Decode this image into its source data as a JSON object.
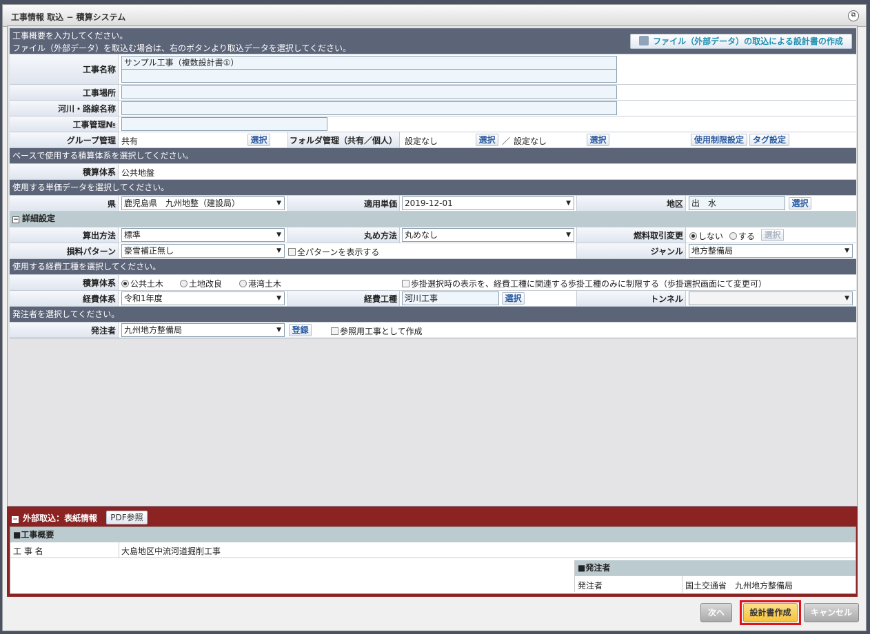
{
  "window": {
    "title": "工事情報 取込 − 積算システム"
  },
  "intro": {
    "line1": "工事概要を入力してください。",
    "line2": "ファイル（外部データ）を取込む場合は、右のボタンより取込データを選択してください。",
    "import_button": "ファイル（外部データ）の取込による設計書の作成"
  },
  "form": {
    "koji_name_label": "工事名称",
    "koji_name_value": "サンプル工事（複数設計書①）",
    "koji_place_label": "工事場所",
    "river_label": "河川・路線名称",
    "koji_no_label": "工事管理№",
    "group_label": "グループ管理",
    "group_value": "共有",
    "select_label": "選択",
    "folder_label": "フォルダ管理（共有／個人）",
    "folder_value1": "設定なし",
    "folder_sep": "／",
    "folder_value2": "設定なし",
    "usage_limit_button": "使用制限設定",
    "tag_button": "タグ設定"
  },
  "section_base": {
    "header": "ベースで使用する積算体系を選択してください。",
    "label": "積算体系",
    "value": "公共地盤"
  },
  "section_unit": {
    "header": "使用する単価データを選択してください。",
    "pref_label": "県",
    "pref_value": "鹿児島県　九州地整（建設局）",
    "date_label": "適用単価",
    "date_value": "2019-12-01",
    "area_label": "地区",
    "area_value": "出　水"
  },
  "detail": {
    "title": "詳細設定",
    "calc_label": "算出方法",
    "calc_value": "標準",
    "round_label": "丸め方法",
    "round_value": "丸めなし",
    "fuel_label": "燃料取引変更",
    "fuel_no": "しない",
    "fuel_yes": "する",
    "loss_label": "損料パターン",
    "loss_value": "豪雪補正無し",
    "show_all_patterns": "全パターンを表示する",
    "genre_label": "ジャンル",
    "genre_value": "地方整備局"
  },
  "section_expense": {
    "header": "使用する経費工種を選択してください。",
    "system_label": "積算体系",
    "opt1": "公共土木",
    "opt2": "土地改良",
    "opt3": "港湾土木",
    "restrict_text": "歩掛選択時の表示を、経費工種に関連する歩掛工種のみに制限する（歩掛選択画面にて変更可）",
    "exp_system_label": "経費体系",
    "exp_system_value": "令和1年度",
    "exp_type_label": "経費工種",
    "exp_type_value": "河川工事",
    "tunnel_label": "トンネル"
  },
  "section_orderer": {
    "header": "発注者を選択してください。",
    "label": "発注者",
    "value": "九州地方整備局",
    "register_button": "登録",
    "reference_text": "参照用工事として作成"
  },
  "external": {
    "title": "外部取込：表紙情報",
    "pdf_button": "PDF参照",
    "overview_header": "■工事概要",
    "name_label": "工 事 名",
    "name_value": "大島地区中流河道掘削工事",
    "orderer_header": "■発注者",
    "orderer_label": "発注者",
    "orderer_value": "国土交通省　九州地方整備局"
  },
  "footer": {
    "next": "次へ",
    "create": "設計書作成",
    "cancel": "キャンセル"
  },
  "colors": {
    "header_bg": "#5c6478",
    "external_bg": "#8b2323",
    "create_bg": "#f6c13c",
    "highlight": "#e0121a"
  }
}
